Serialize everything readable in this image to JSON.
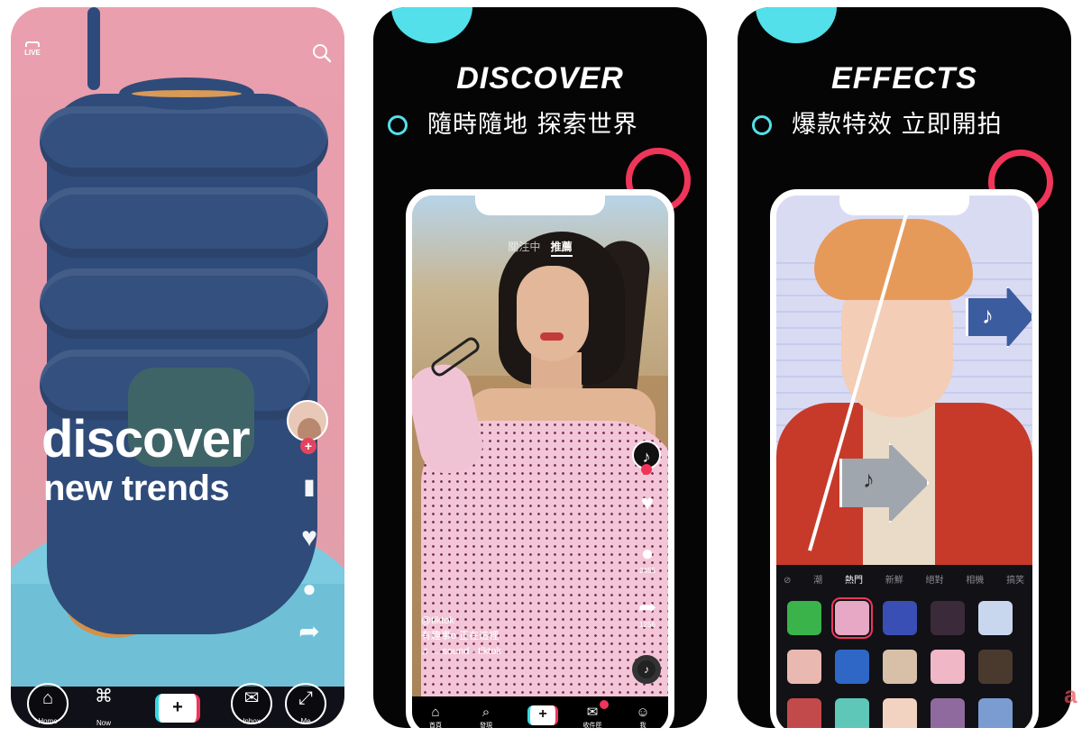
{
  "panel1": {
    "live_label": "LIVE",
    "headline_line1": "discover",
    "headline_line2": "new trends",
    "nav": [
      {
        "icon": "home-icon",
        "glyph": "⌂",
        "label": "Home"
      },
      {
        "icon": "now-icon",
        "glyph": "⌘",
        "label": "Now"
      },
      {
        "icon": "plus-icon",
        "glyph": "+",
        "label": ""
      },
      {
        "icon": "inbox-icon",
        "glyph": "✉",
        "label": "Inbox"
      },
      {
        "icon": "me-icon",
        "glyph": "⤢",
        "label": "Me"
      }
    ]
  },
  "panel2": {
    "title": "DISCOVER",
    "subtitle": "隨時隨地 探索世界",
    "tabs": {
      "following": "關注中",
      "for_you": "推薦"
    },
    "comments_count": "2455",
    "shares_count": "1256",
    "caption_user": "@tiktok",
    "caption_text": "有趣事o 正在這裡",
    "sound_text": "♫ ... sound - tiktok",
    "nav": [
      {
        "icon": "home-icon",
        "glyph": "⌂",
        "label": "首頁"
      },
      {
        "icon": "discover-icon",
        "glyph": "⌕",
        "label": "發現"
      },
      {
        "icon": "plus-icon",
        "glyph": "+",
        "label": ""
      },
      {
        "icon": "inbox-icon",
        "glyph": "✉",
        "label": "收件匣"
      },
      {
        "icon": "me-icon",
        "glyph": "☺",
        "label": "我"
      }
    ]
  },
  "panel3": {
    "title": "EFFECTS",
    "subtitle": "爆款特效 立即開拍",
    "tabs": [
      "⊘",
      "潮",
      "熱門",
      "新鮮",
      "絕對",
      "相機",
      "搞笑"
    ],
    "active_tab": "熱門",
    "effect_colors": [
      "#3ab34a",
      "#e7a8c6",
      "#3a4fb5",
      "#3b2a3a",
      "#c9d7ee",
      "#e9b8b0",
      "#2f67c7",
      "#d7c0a7",
      "#f0b7c6",
      "#4a3a2e",
      "#c34a4a",
      "#5ec7b8",
      "#f2d3c2",
      "#8e6a9e",
      "#7a9cd1"
    ],
    "selected_index": 1
  },
  "brand_partial": "a",
  "colors": {
    "accent_cyan": "#53e0ea",
    "accent_red": "#f0355a",
    "panel_bg": "#050505"
  }
}
